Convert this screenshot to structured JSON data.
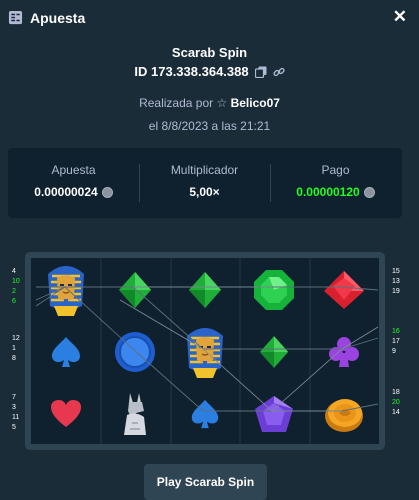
{
  "header": {
    "title": "Apuesta"
  },
  "game": {
    "name": "Scarab Spin",
    "bet_id": "ID 173.338.364.388"
  },
  "meta": {
    "placed_prefix": "Realizada por",
    "username": "Belico07",
    "date": "el 8/8/2023 a las 21:21"
  },
  "stats": {
    "bet_label": "Apuesta",
    "bet_value": "0.00000024",
    "multiplier_label": "Multiplicador",
    "multiplier_value": "5,00×",
    "payout_label": "Pago",
    "payout_value": "0.00000120"
  },
  "colors": {
    "payout_green": "#1fff20",
    "background": "#1a2c38",
    "panel": "#0f212e",
    "muted_text": "#b1bad3"
  },
  "grid": [
    [
      "pharaoh",
      "green-diamond",
      "green-diamond",
      "emerald",
      "ruby"
    ],
    [
      "spade",
      "blue-coin",
      "pharaoh",
      "green-diamond",
      "club"
    ],
    [
      "heart",
      "anubis-statue",
      "spade",
      "amethyst",
      "gold-scarab-coin"
    ]
  ],
  "paylines_left": [
    [
      {
        "n": "4",
        "hl": false
      },
      {
        "n": "10",
        "hl": true
      },
      {
        "n": "2",
        "hl": true
      },
      {
        "n": "6",
        "hl": true
      }
    ],
    [
      {
        "n": "12",
        "hl": false
      },
      {
        "n": "1",
        "hl": false
      },
      {
        "n": "8",
        "hl": false
      }
    ],
    [
      {
        "n": "7",
        "hl": false
      },
      {
        "n": "3",
        "hl": false
      },
      {
        "n": "11",
        "hl": false
      },
      {
        "n": "5",
        "hl": false
      }
    ]
  ],
  "paylines_right": [
    [
      {
        "n": "15",
        "hl": false
      },
      {
        "n": "13",
        "hl": false
      },
      {
        "n": "19",
        "hl": false
      }
    ],
    [
      {
        "n": "16",
        "hl": true
      },
      {
        "n": "17",
        "hl": false
      },
      {
        "n": "9",
        "hl": false
      }
    ],
    [
      {
        "n": "18",
        "hl": false
      },
      {
        "n": "20",
        "hl": true
      },
      {
        "n": "14",
        "hl": false
      }
    ]
  ],
  "button": {
    "label": "Play Scarab Spin"
  }
}
